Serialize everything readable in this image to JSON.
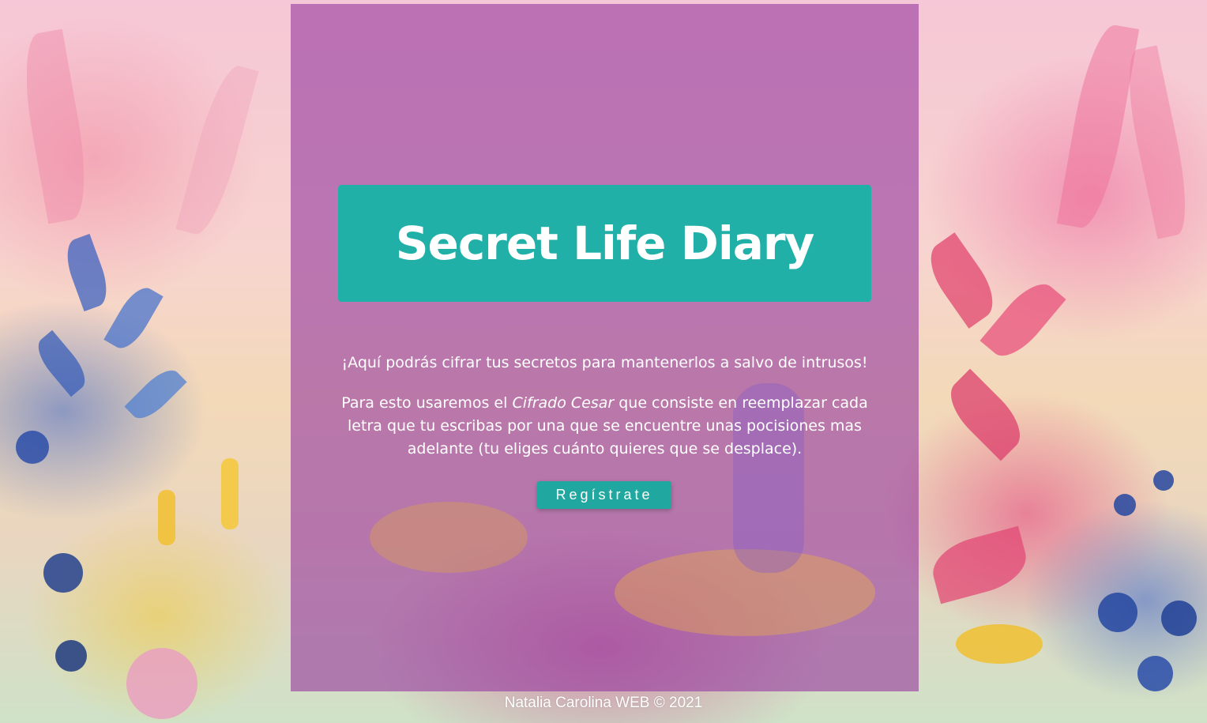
{
  "header": {
    "title": "Secret Life Diary"
  },
  "main": {
    "intro": "¡Aquí podrás cifrar tus secretos para mantenerlos a salvo de intrusos!",
    "desc_before": "Para esto usaremos el ",
    "desc_emphasis": "Cifrado Cesar",
    "desc_after": " que consiste en reemplazar cada letra que tu escribas por una que se encuentre unas pocisiones mas adelante (tu eliges cuánto quieres que se desplace).",
    "register_label": "Regístrate"
  },
  "footer": {
    "text": "Natalia Carolina WEB © 2021"
  },
  "colors": {
    "panel_overlay": "#963ca0",
    "title_bg": "#20b0a8",
    "button_bg": "#20a8a0",
    "text": "#ffffff"
  }
}
